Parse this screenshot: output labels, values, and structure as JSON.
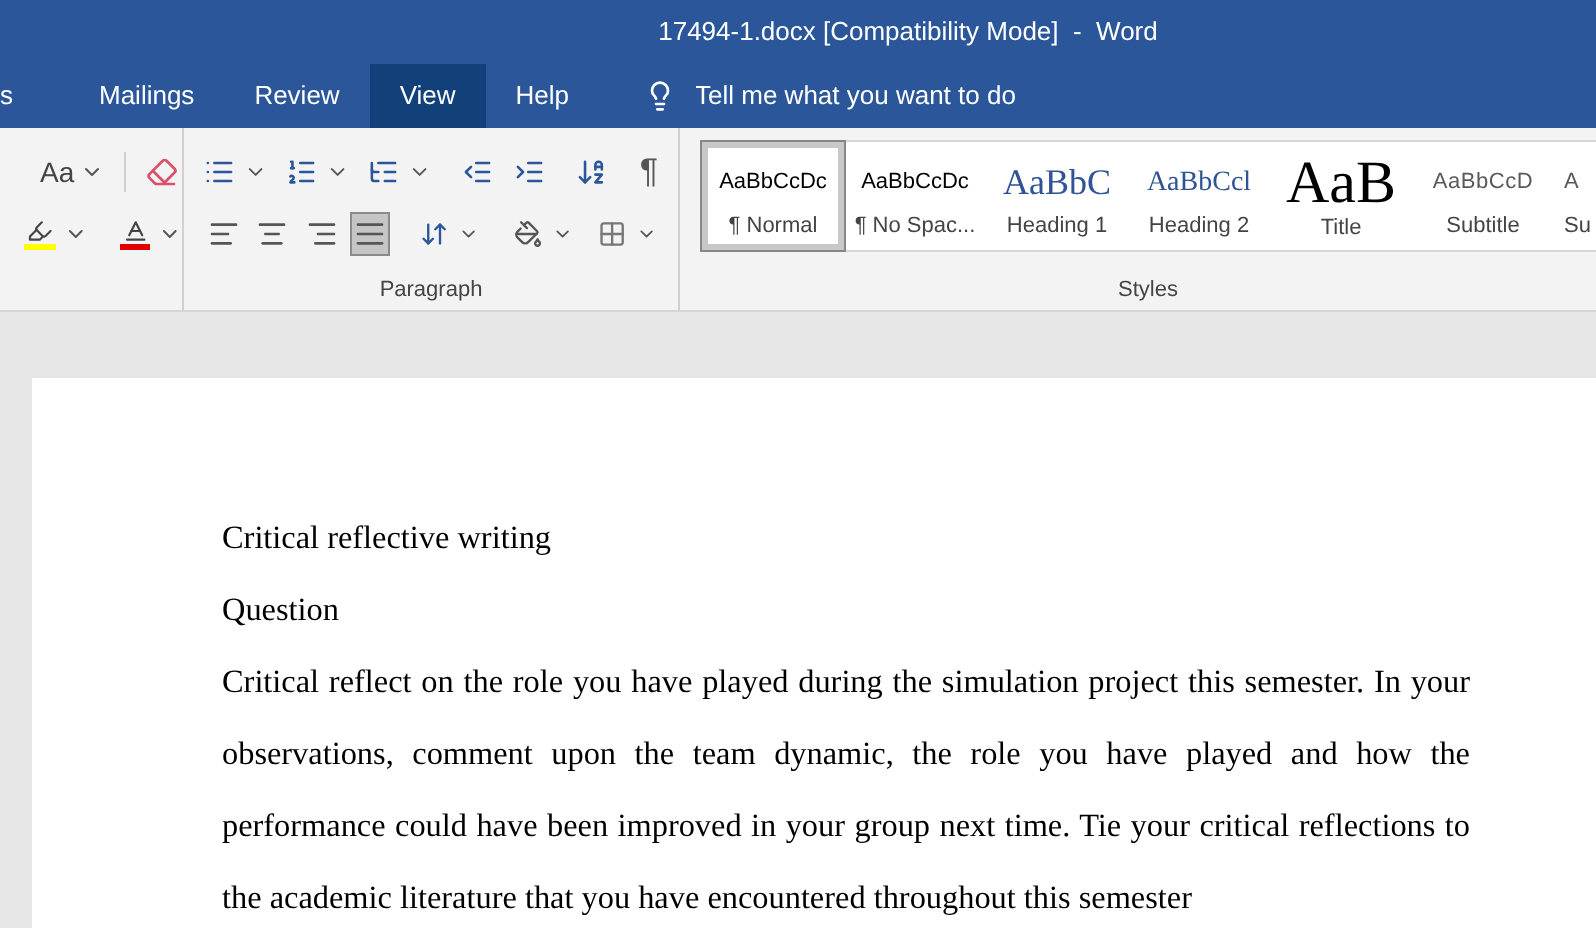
{
  "window": {
    "title": "17494-1.docx [Compatibility Mode]  -  Word"
  },
  "tabs": [
    {
      "label": "s",
      "selected": false
    },
    {
      "label": "Mailings",
      "selected": false
    },
    {
      "label": "Review",
      "selected": false
    },
    {
      "label": "View",
      "selected": true
    },
    {
      "label": "Help",
      "selected": false
    }
  ],
  "tell_me": {
    "placeholder": "Tell me what you want to do"
  },
  "font_group": {
    "change_case": "Aa"
  },
  "paragraph_group": {
    "label": "Paragraph",
    "show_marks": "¶",
    "alignments": [
      {
        "kind": "left",
        "selected": false
      },
      {
        "kind": "center",
        "selected": false
      },
      {
        "kind": "right",
        "selected": false
      },
      {
        "kind": "justify",
        "selected": true
      }
    ]
  },
  "styles_group": {
    "label": "Styles",
    "styles": [
      {
        "kind": "normal",
        "sample": "AaBbCcDc",
        "name": "¶ Normal",
        "selected": true
      },
      {
        "kind": "normal",
        "sample": "AaBbCcDc",
        "name": "¶ No Spac...",
        "selected": false
      },
      {
        "kind": "heading1",
        "sample": "AaBbC",
        "name": "Heading 1",
        "selected": false
      },
      {
        "kind": "heading2",
        "sample": "AaBbCcl",
        "name": "Heading 2",
        "selected": false
      },
      {
        "kind": "title",
        "sample": "AaB",
        "name": "Title",
        "selected": false
      },
      {
        "kind": "subtitle",
        "sample": "AaBbCcD",
        "name": "Subtitle",
        "selected": false
      },
      {
        "kind": "subtitle",
        "sample": "A",
        "name": "Su",
        "selected": false
      }
    ]
  },
  "document": {
    "paragraphs": [
      "Critical reflective writing",
      "Question",
      "Critical reflect on the role you have played during the simulation project this semester. In your observations, comment upon the team dynamic, the role you have played and how the performance could have been improved in your group next time. Tie your critical reflections to the academic literature that you have encountered throughout this semester"
    ]
  }
}
